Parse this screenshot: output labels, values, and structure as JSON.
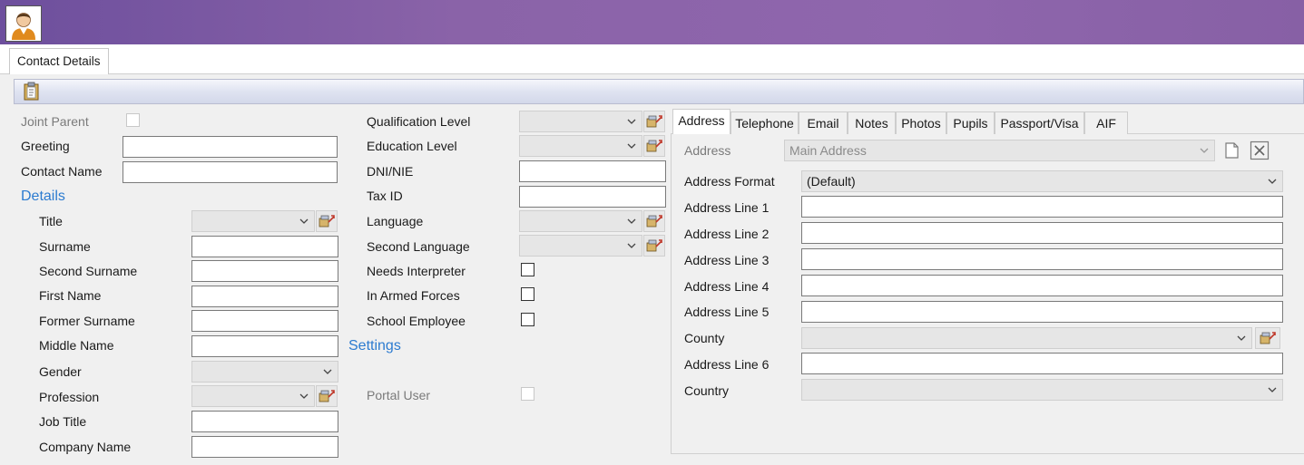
{
  "window": {
    "tab_label": "Contact Details"
  },
  "left": {
    "joint_parent": "Joint Parent",
    "greeting": "Greeting",
    "contact_name": "Contact Name",
    "details_heading": "Details",
    "title": "Title",
    "surname": "Surname",
    "second_surname": "Second Surname",
    "first_name": "First Name",
    "former_surname": "Former Surname",
    "middle_name": "Middle Name",
    "gender": "Gender",
    "profession": "Profession",
    "job_title": "Job Title",
    "company_name": "Company Name"
  },
  "middle": {
    "qualification_level": "Qualification Level",
    "education_level": "Education Level",
    "dni_nie": "DNI/NIE",
    "tax_id": "Tax ID",
    "language": "Language",
    "second_language": "Second Language",
    "needs_interpreter": "Needs Interpreter",
    "in_armed_forces": "In Armed Forces",
    "school_employee": "School Employee",
    "settings_heading": "Settings",
    "portal_user": "Portal User"
  },
  "subtabs": [
    "Address",
    "Telephone",
    "Email",
    "Notes",
    "Photos",
    "Pupils",
    "Passport/Visa",
    "AIF"
  ],
  "address": {
    "address_label": "Address",
    "address_value": "Main Address",
    "format_label": "Address Format",
    "format_value": "(Default)",
    "line1": "Address Line 1",
    "line2": "Address Line 2",
    "line3": "Address Line 3",
    "line4": "Address Line 4",
    "line5": "Address Line 5",
    "county": "County",
    "line6": "Address Line 6",
    "country": "Country"
  },
  "colors": {
    "header_purple": "#8a63a8",
    "section_blue": "#2c7bd0"
  },
  "icons": [
    "user-avatar-icon",
    "clipboard-icon",
    "chevron-down-icon",
    "lookup-icon",
    "new-document-icon",
    "delete-icon"
  ]
}
